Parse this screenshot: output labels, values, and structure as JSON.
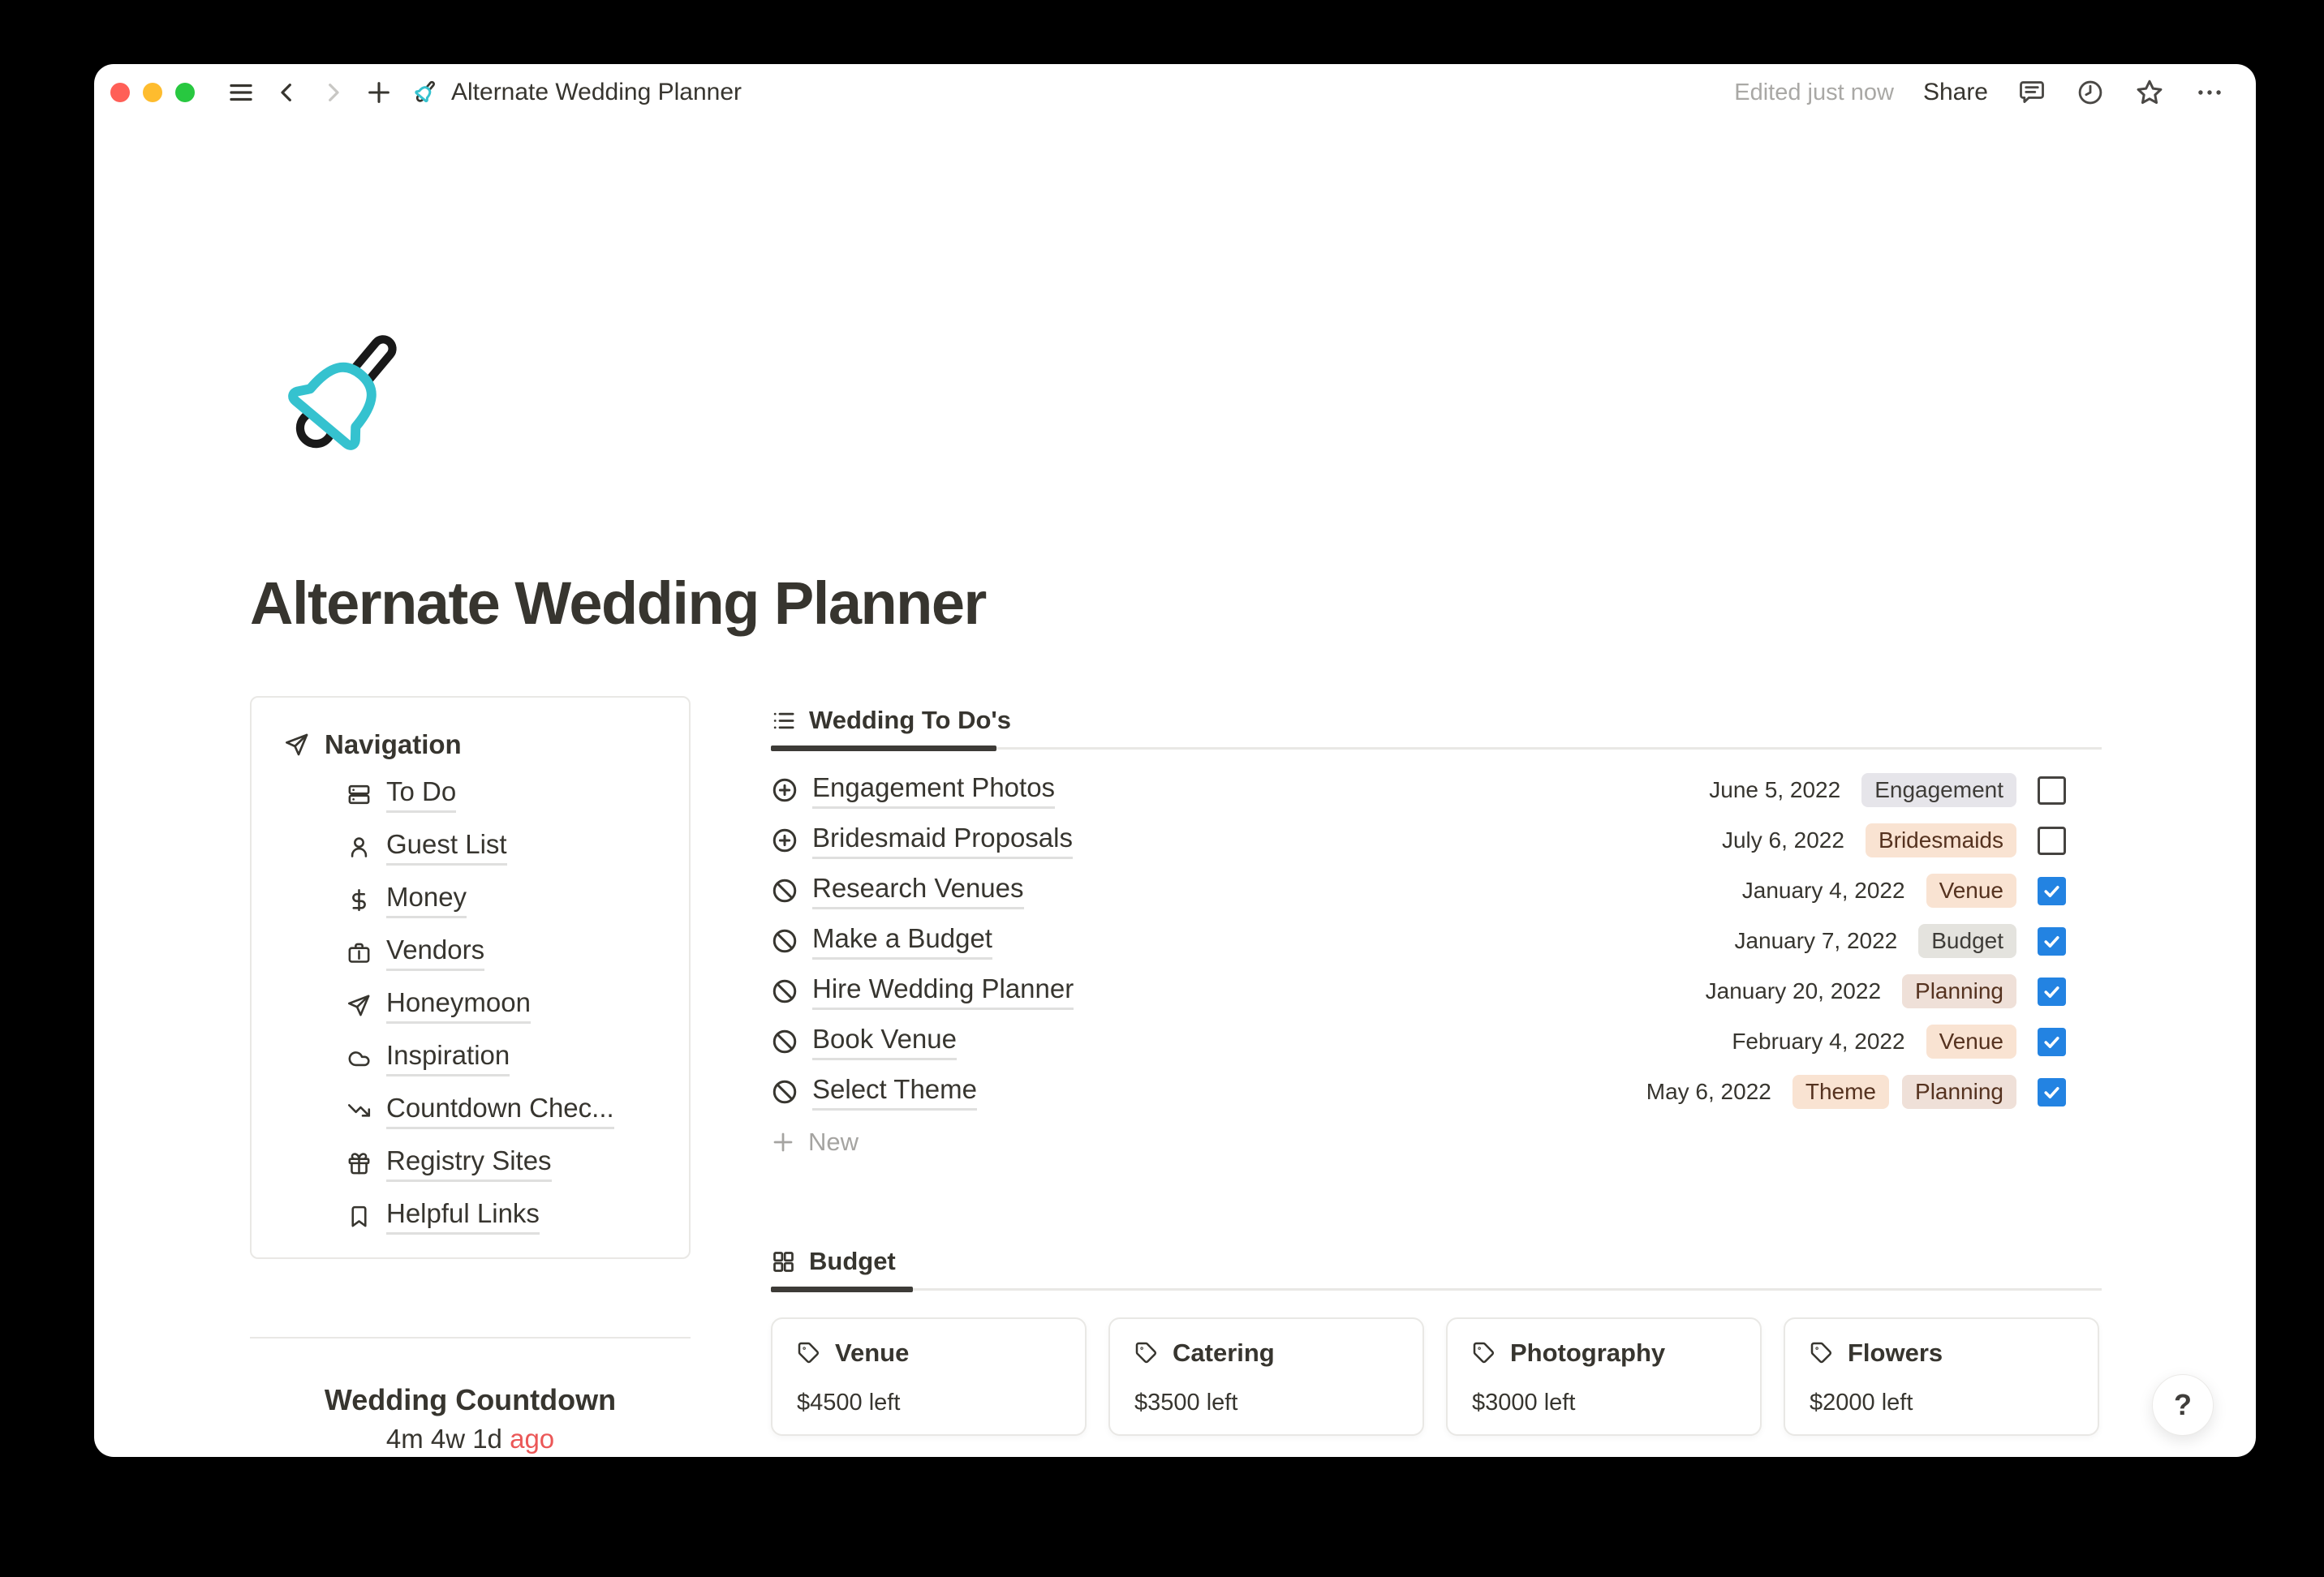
{
  "titlebar": {
    "title": "Alternate Wedding Planner",
    "edited_status": "Edited just now",
    "share_label": "Share"
  },
  "page": {
    "icon": "hand-bell-icon",
    "title": "Alternate Wedding Planner"
  },
  "navigation": {
    "header": "Navigation",
    "items": [
      {
        "label": "To Do",
        "icon": "database-icon"
      },
      {
        "label": "Guest List",
        "icon": "person-icon"
      },
      {
        "label": "Money",
        "icon": "dollar-icon"
      },
      {
        "label": "Vendors",
        "icon": "briefcase-icon"
      },
      {
        "label": "Honeymoon",
        "icon": "paper-plane-icon"
      },
      {
        "label": "Inspiration",
        "icon": "cloud-icon"
      },
      {
        "label": "Countdown Chec...",
        "icon": "trending-down-icon"
      },
      {
        "label": "Registry Sites",
        "icon": "gift-icon"
      },
      {
        "label": "Helpful Links",
        "icon": "bookmark-icon"
      }
    ]
  },
  "todo": {
    "tab_label": "Wedding To Do's",
    "rows": [
      {
        "title": "Engagement Photos",
        "icon": "circle-plus-icon",
        "date": "June 5, 2022",
        "checked": false,
        "tags": [
          {
            "label": "Engagement",
            "bg": "#E6E5EA",
            "fg": "#3E3C38"
          }
        ]
      },
      {
        "title": "Bridesmaid Proposals",
        "icon": "circle-plus-icon",
        "date": "July 6, 2022",
        "checked": false,
        "tags": [
          {
            "label": "Bridesmaids",
            "bg": "#F9E3D2",
            "fg": "#55321F"
          }
        ]
      },
      {
        "title": "Research Venues",
        "icon": "circle-slash-icon",
        "date": "January 4, 2022",
        "checked": true,
        "tags": [
          {
            "label": "Venue",
            "bg": "#F9E3D2",
            "fg": "#55321F"
          }
        ]
      },
      {
        "title": "Make a Budget",
        "icon": "circle-slash-icon",
        "date": "January 7, 2022",
        "checked": true,
        "tags": [
          {
            "label": "Budget",
            "bg": "#E4E3DE",
            "fg": "#3E3C38"
          }
        ]
      },
      {
        "title": "Hire Wedding Planner",
        "icon": "circle-slash-icon",
        "date": "January 20, 2022",
        "checked": true,
        "tags": [
          {
            "label": "Planning",
            "bg": "#EFE0D8",
            "fg": "#55321F"
          }
        ]
      },
      {
        "title": "Book Venue",
        "icon": "circle-slash-icon",
        "date": "February 4, 2022",
        "checked": true,
        "tags": [
          {
            "label": "Venue",
            "bg": "#F9E3D2",
            "fg": "#55321F"
          }
        ]
      },
      {
        "title": "Select Theme",
        "icon": "circle-slash-icon",
        "date": "May 6, 2022",
        "checked": true,
        "tags": [
          {
            "label": "Theme",
            "bg": "#F9E3D2",
            "fg": "#55321F"
          },
          {
            "label": "Planning",
            "bg": "#EFE0D8",
            "fg": "#55321F"
          }
        ]
      }
    ],
    "new_label": "New"
  },
  "budget": {
    "tab_label": "Budget",
    "cards": [
      {
        "title": "Venue",
        "amount": "$4500 left"
      },
      {
        "title": "Catering",
        "amount": "$3500 left"
      },
      {
        "title": "Photography",
        "amount": "$3000 left"
      },
      {
        "title": "Flowers",
        "amount": "$2000 left"
      }
    ]
  },
  "countdown": {
    "title": "Wedding Countdown",
    "value": "4m 4w 1d",
    "suffix": "ago"
  },
  "help_label": "?",
  "colors": {
    "accent_teal": "#35C2CF",
    "checkbox_checked_blue": "#2383E2",
    "countdown_red": "#EB5757",
    "text_dark": "#37352F",
    "text_gray": "#A5A4A1",
    "traffic_red": "#FF5F57",
    "traffic_yellow": "#FEBC2E",
    "traffic_green": "#28C840"
  }
}
